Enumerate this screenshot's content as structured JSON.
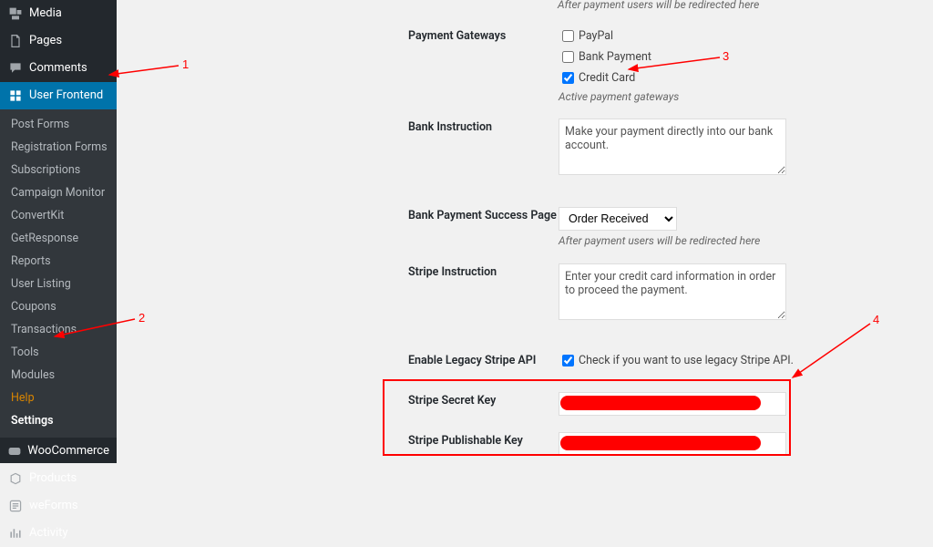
{
  "sidebar": {
    "top": [
      {
        "icon": "media",
        "label": "Media"
      },
      {
        "icon": "pages",
        "label": "Pages"
      },
      {
        "icon": "comments",
        "label": "Comments"
      },
      {
        "icon": "uf",
        "label": "User Frontend",
        "active": true
      }
    ],
    "submenu": [
      {
        "label": "Post Forms"
      },
      {
        "label": "Registration Forms"
      },
      {
        "label": "Subscriptions"
      },
      {
        "label": "Campaign Monitor"
      },
      {
        "label": "ConvertKit"
      },
      {
        "label": "GetResponse"
      },
      {
        "label": "Reports"
      },
      {
        "label": "User Listing"
      },
      {
        "label": "Coupons"
      },
      {
        "label": "Transactions"
      },
      {
        "label": "Tools"
      },
      {
        "label": "Modules"
      },
      {
        "label": "Help",
        "orange": true
      },
      {
        "label": "Settings",
        "sel": true
      }
    ],
    "bottom": [
      {
        "icon": "woo",
        "label": "WooCommerce"
      },
      {
        "icon": "products",
        "label": "Products"
      },
      {
        "icon": "weforms",
        "label": "weForms"
      },
      {
        "icon": "activity",
        "label": "Activity"
      }
    ]
  },
  "form": {
    "redirect_hint": "After payment users will be redirected here",
    "gateways": {
      "label": "Payment Gateways",
      "opts": [
        {
          "label": "PayPal",
          "checked": false
        },
        {
          "label": "Bank Payment",
          "checked": false
        },
        {
          "label": "Credit Card",
          "checked": true
        }
      ],
      "hint": "Active payment gateways"
    },
    "bank_instr": {
      "label": "Bank Instruction",
      "value": "Make your payment directly into our bank account."
    },
    "bank_success": {
      "label": "Bank Payment Success Page",
      "selected": "Order Received",
      "hint": "After payment users will be redirected here"
    },
    "stripe_instr": {
      "label": "Stripe Instruction",
      "value": "Enter your credit card information in order to proceed the payment."
    },
    "legacy": {
      "label": "Enable Legacy Stripe API",
      "chk_label": "Check if you want to use legacy Stripe API.",
      "checked": true
    },
    "secret": {
      "label": "Stripe Secret Key"
    },
    "publish": {
      "label": "Stripe Publishable Key"
    }
  },
  "ann": {
    "n1": "1",
    "n2": "2",
    "n3": "3",
    "n4": "4"
  }
}
